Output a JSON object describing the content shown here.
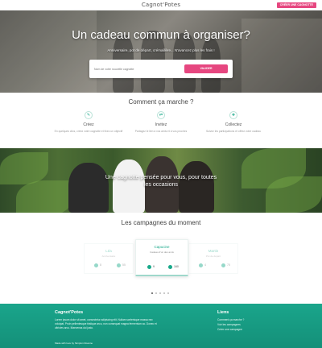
{
  "header": {
    "logo": "Cagnot'Potes",
    "cta": "CRÉER UNE CAGNOTTE"
  },
  "hero": {
    "title": "Un cadeau commun à organiser?",
    "subtitle": "Anniversaire, pot de départ, crémaillère... N'avancez plus les frais !",
    "input_placeholder": "Nom de votre nouvelle cagnotte",
    "button": "VALIDER"
  },
  "how": {
    "title": "Comment ça marche ?",
    "steps": [
      {
        "icon": "pencil-icon",
        "glyph": "✎",
        "title": "Créez",
        "desc": "En quelques clics, créez votre cagnotte et fixez un objectif"
      },
      {
        "icon": "share-icon",
        "glyph": "⇄",
        "title": "Invitez",
        "desc": "Partagez le lien à vos amis et à vos proches"
      },
      {
        "icon": "gift-icon",
        "glyph": "❖",
        "title": "Collectez",
        "desc": "Suivez les participations et offrez votre cadeau"
      }
    ]
  },
  "band": {
    "text": "Une cagnotte pensée pour vous, pour toutes les occasions"
  },
  "campaigns": {
    "title": "Les campagnes du moment",
    "cards": [
      {
        "name": "Léa",
        "sub": "Anniversaire",
        "participants": "8",
        "amount": "55"
      },
      {
        "name": "Capucine",
        "sub": "Cadeau d'un des amis",
        "participants": "9",
        "amount": "160"
      },
      {
        "name": "Martin",
        "sub": "Pot de départ",
        "participants": "4",
        "amount": "75"
      }
    ],
    "pager_count": 5,
    "pager_active": 0
  },
  "footer": {
    "brand": "Cagnot'Potes",
    "desc": "Lorem ipsum dolor sit amet, consectetur adipiscing elit. Nullam scelerisque massa nec volutpat. Proin pellentesque tristique arcu, non consequat magna fermentum ac. Donec et ultricies arcu. Maecenas dui justo.",
    "links_title": "Liens",
    "links": [
      "Comment ça marche ?",
      "Voir les campagnes",
      "Créer une campagne"
    ],
    "made_by": "Made with love by Simplon Roanne"
  },
  "colors": {
    "accent": "#e64780",
    "teal": "#19a98a",
    "footer": "#16997f"
  }
}
